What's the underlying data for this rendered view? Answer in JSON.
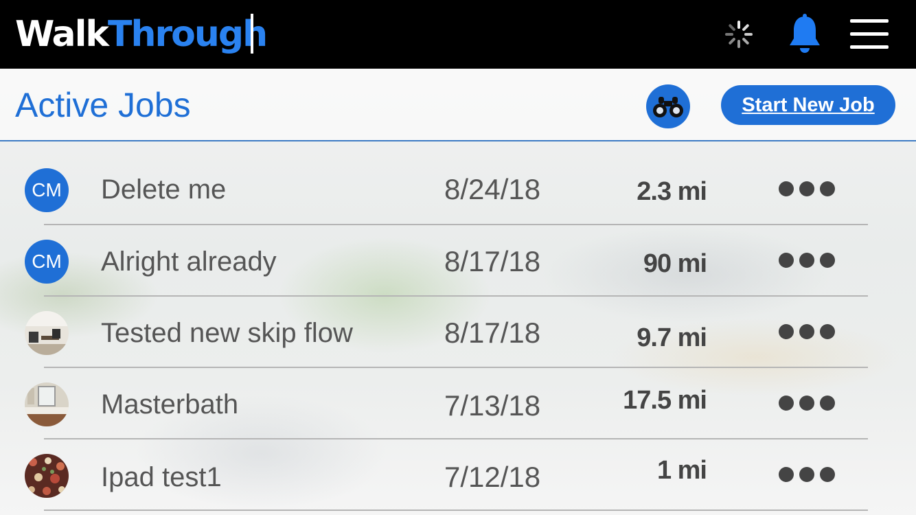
{
  "app": {
    "logo_part1": "Walk",
    "logo_part2": "Through"
  },
  "colors": {
    "brand_blue": "#1f6fd6",
    "logo_blue": "#2a82f0",
    "topbar": "#000000"
  },
  "header": {
    "title": "Active Jobs",
    "search_icon": "binoculars-icon",
    "new_job_label": "Start New Job"
  },
  "topbar_icons": [
    "loading-spinner-icon",
    "bell-icon",
    "hamburger-menu-icon"
  ],
  "jobs": [
    {
      "avatar": "CM",
      "avatar_type": "initials",
      "name": "Delete me",
      "date": "8/24/18",
      "distance": "2.3 mi"
    },
    {
      "avatar": "CM",
      "avatar_type": "initials",
      "name": "Alright already",
      "date": "8/17/18",
      "distance": "90 mi"
    },
    {
      "avatar": "",
      "avatar_type": "photo-office",
      "name": "Tested new skip flow",
      "date": "8/17/18",
      "distance": "9.7 mi"
    },
    {
      "avatar": "",
      "avatar_type": "photo-bathroom",
      "name": "Masterbath",
      "date": "7/13/18",
      "distance": "17.5 mi"
    },
    {
      "avatar": "",
      "avatar_type": "photo-floral",
      "name": "Ipad test1",
      "date": "7/12/18",
      "distance": "1 mi"
    }
  ]
}
